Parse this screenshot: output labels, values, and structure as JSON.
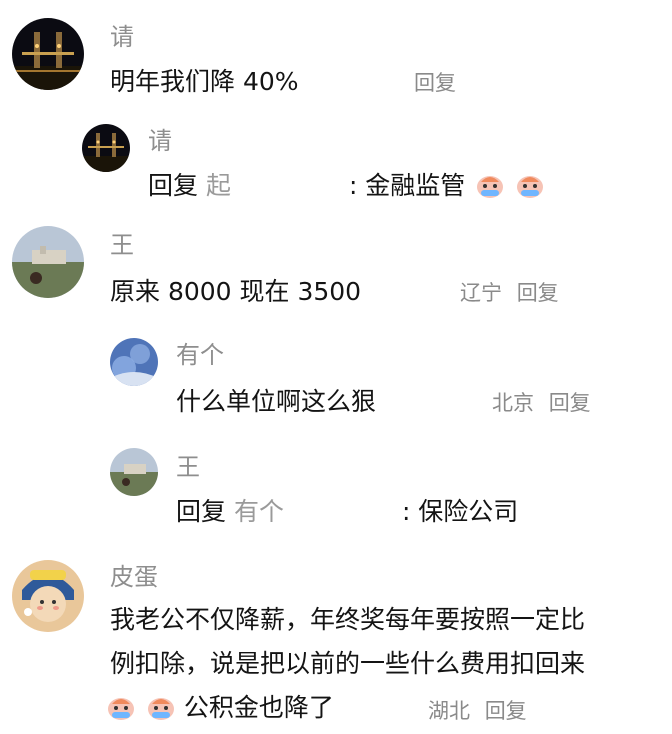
{
  "comments": [
    {
      "username": "请",
      "text": "明年我们降 40%",
      "reply_label": "回复",
      "avatar_icon": "night-bridge-photo"
    },
    {
      "username": "请",
      "reply_prefix": "回复",
      "reply_to": "起",
      "text": ": 金融监管",
      "emoji_icon": "crying-face-emoji",
      "avatar_icon": "night-bridge-photo"
    },
    {
      "username": "王",
      "text": "原来 8000 现在 3500",
      "location": "辽宁",
      "reply_label": "回复",
      "avatar_icon": "landscape-photo"
    },
    {
      "username": "有个",
      "text": "什么单位啊这么狠",
      "location": "北京",
      "reply_label": "回复",
      "avatar_icon": "blue-sky-photo"
    },
    {
      "username": "王",
      "reply_prefix": "回复",
      "reply_to": "有个",
      "text": ": 保险公司",
      "avatar_icon": "landscape-photo"
    },
    {
      "username": "皮蛋",
      "text_line1": "我老公不仅降薪，年终奖每年要按照一定比",
      "text_line2": "例扣除，说是把以前的一些什么费用扣回来",
      "text_line3": "公积金也降了",
      "location": "湖北",
      "reply_label": "回复",
      "emoji_icon": "crying-face-emoji",
      "avatar_icon": "cartoon-girl-avatar"
    }
  ],
  "colors": {
    "username": "#8e8e8e",
    "text": "#141414",
    "meta": "#8a8a8a"
  }
}
